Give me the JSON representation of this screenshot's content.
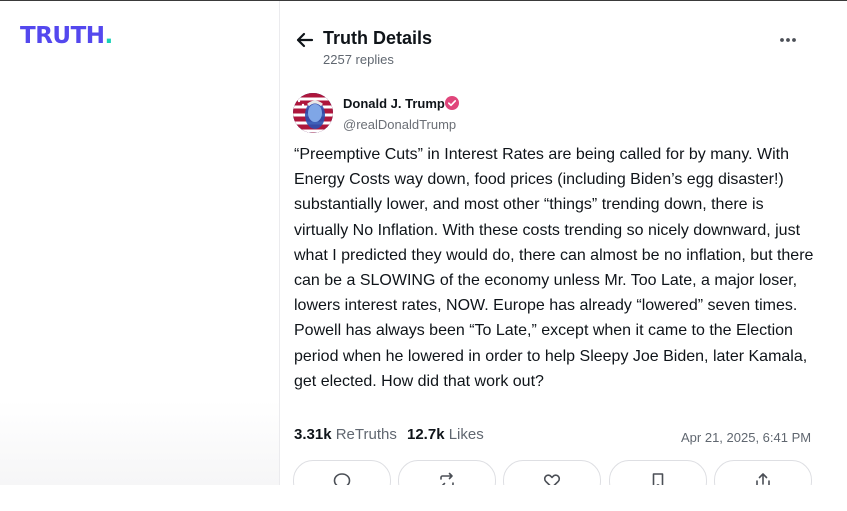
{
  "brand": {
    "logo_text": "TRUTH",
    "logo_dot": ".",
    "logo_color": "#5448ee",
    "dot_color": "#17d2b7"
  },
  "header": {
    "title": "Truth Details",
    "replies": "2257 replies"
  },
  "post": {
    "author_name": "Donald J. Trump",
    "author_handle": "@realDonaldTrump",
    "verified": true,
    "text": "“Preemptive Cuts” in Interest Rates are being called for by many. With Energy Costs way down, food prices (including Biden’s egg disaster!) substantially lower, and most other “things” trending down, there is virtually No Inflation. With these costs trending so nicely downward, just what I predicted they would do, there can almost be no inflation, but there can be a SLOWING of the economy unless Mr. Too Late, a major loser, lowers interest rates, NOW. Europe has already “lowered” seven times. Powell has always been “To Late,” except when it came to the Election period when he lowered in order to help Sleepy Joe Biden, later Kamala, get elected. How did that work out?",
    "retruths_count": "3.31k",
    "retruths_label": "ReTruths",
    "likes_count": "12.7k",
    "likes_label": "Likes",
    "timestamp": "Apr 21, 2025, 6:41 PM"
  },
  "actions": [
    "reply-icon",
    "retruth-icon",
    "like-icon",
    "bookmark-icon",
    "share-icon"
  ]
}
